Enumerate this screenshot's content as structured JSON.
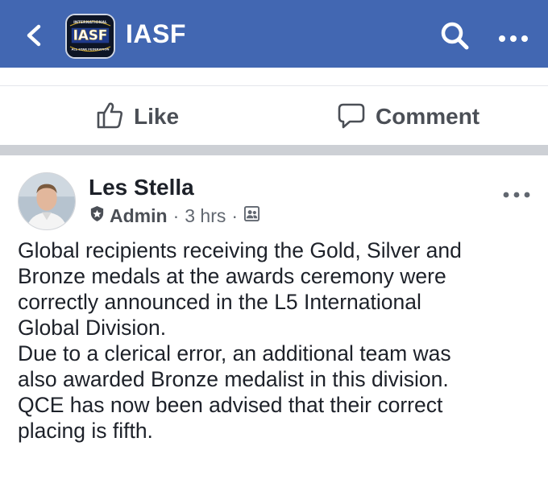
{
  "navbar": {
    "page_name": "IASF",
    "logo_text": {
      "top": "INTERNATIONAL",
      "center": "IASF",
      "bottom": "ALL STAR FEDERATION"
    },
    "icons": [
      "back-chevron",
      "search",
      "more-dots"
    ],
    "background_color": "#4267b2"
  },
  "actions": {
    "like_label": "Like",
    "comment_label": "Comment"
  },
  "post": {
    "author": "Les Stella",
    "role": "Admin",
    "separator": "·",
    "time": "3 hrs",
    "audience_icon": "group-audience",
    "text_lines": [
      "Global recipients receiving the Gold, Silver and",
      "Bronze medals at the awards ceremony were",
      "correctly announced in the L5 International",
      "Global Division.",
      "Due to a clerical error, an additional team was",
      "also awarded Bronze medalist in this division.",
      "QCE has now been advised that their correct",
      "placing is fifth."
    ]
  }
}
